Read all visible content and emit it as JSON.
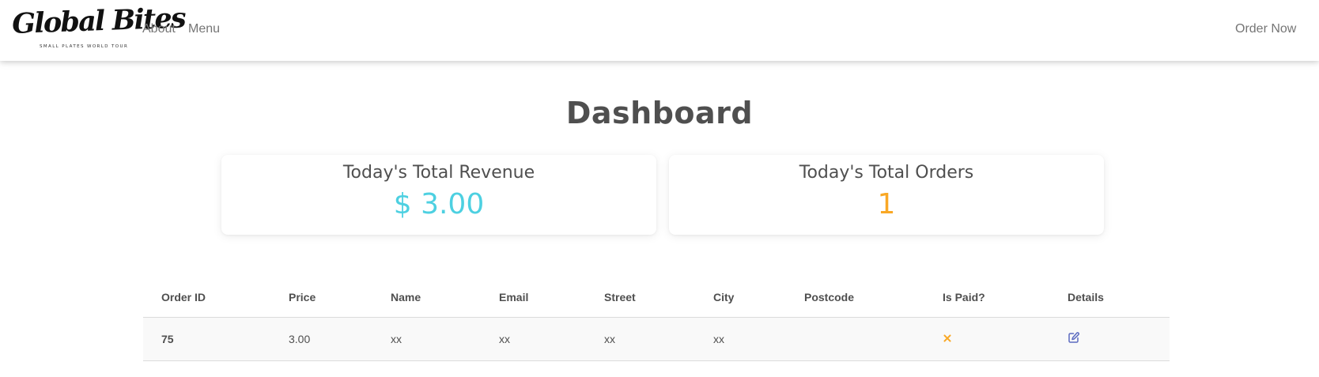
{
  "brand": {
    "name": "Global Bites",
    "tagline": "SMALL PLATES WORLD TOUR"
  },
  "nav": {
    "about": "About",
    "menu": "Menu",
    "order_now": "Order Now"
  },
  "dashboard": {
    "title": "Dashboard",
    "revenue": {
      "label": "Today's Total Revenue",
      "value": "$ 3.00"
    },
    "orders": {
      "label": "Today's Total Orders",
      "value": "1"
    }
  },
  "table": {
    "columns": [
      "Order ID",
      "Price",
      "Name",
      "Email",
      "Street",
      "City",
      "Postcode",
      "Is Paid?",
      "Details"
    ],
    "rows": [
      {
        "order_id": "75",
        "price": "3.00",
        "name": "xx",
        "email": "xx",
        "street": "xx",
        "city": "xx",
        "postcode": "",
        "is_paid_icon": "close-icon",
        "details_icon": "edit-icon"
      }
    ]
  },
  "colors": {
    "revenue_value": "#4dd0e1",
    "orders_value": "#f9a825",
    "unpaid_icon": "#f9a825",
    "edit_icon": "#5c6bc0",
    "text": "#4f4f4f",
    "nav_link": "#757575"
  }
}
